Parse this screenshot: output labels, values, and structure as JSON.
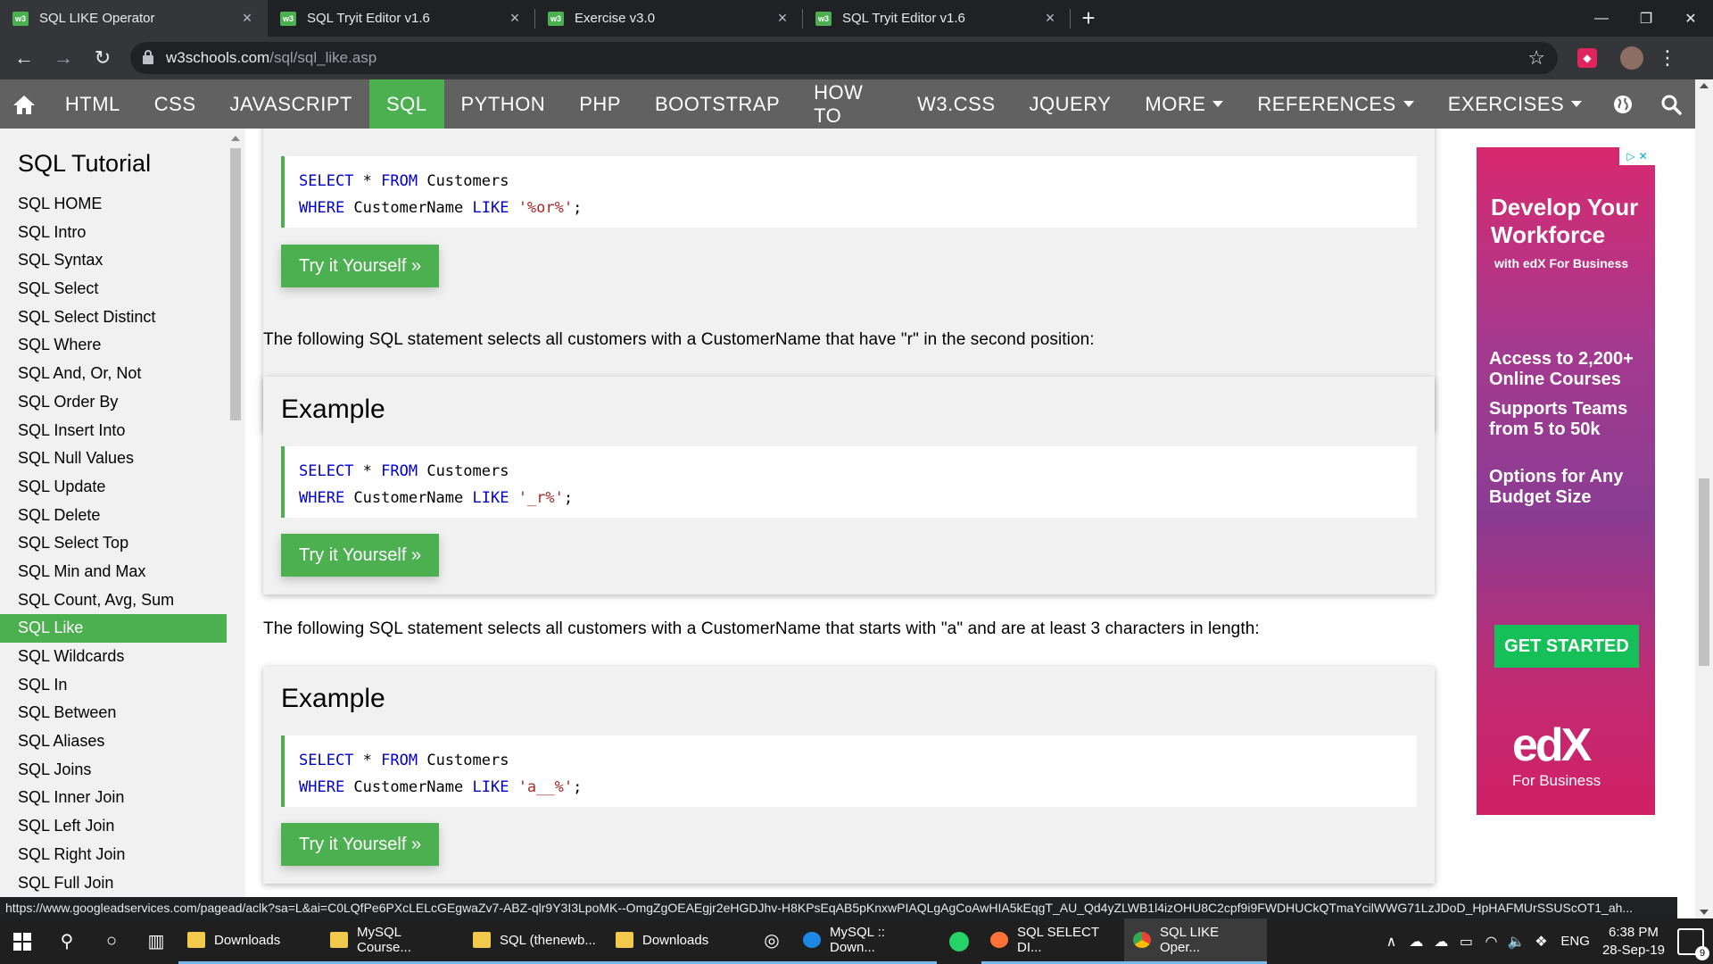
{
  "browser": {
    "tabs": [
      {
        "label": "SQL LIKE Operator",
        "favicon": "w3"
      },
      {
        "label": "SQL Tryit Editor v1.6",
        "favicon": "w3"
      },
      {
        "label": "Exercise v3.0",
        "favicon": "w3"
      },
      {
        "label": "SQL Tryit Editor v1.6",
        "favicon": "w3"
      }
    ],
    "url_host": "w3schools.com",
    "url_path": "/sql/sql_like.asp",
    "status_url": "https://www.googleadservices.com/pagead/aclk?sa=L&ai=C0LQfPe6PXcLELcGEgwaZv7-ABZ-qlr9Y3I3LpoMK--OmgZgOEAEgjr2eHGDJhv-H8KPsEqAB5pKnxwPIAQLgAgCoAwHIA5kEqgT_AU_Qd4yZLWB1l4izOHU8C2cpf9i9FWDHUCkQTmaYcilWWG71LzJDoD_HpHAFMUrSSUScOT1_ah..."
  },
  "topnav": {
    "links": [
      "HTML",
      "CSS",
      "JAVASCRIPT",
      "SQL",
      "PYTHON",
      "PHP",
      "BOOTSTRAP",
      "HOW TO",
      "W3.CSS",
      "JQUERY",
      "MORE"
    ],
    "active": "SQL",
    "right_links": [
      "REFERENCES",
      "EXERCISES"
    ]
  },
  "sidebar": {
    "title": "SQL Tutorial",
    "items": [
      "SQL HOME",
      "SQL Intro",
      "SQL Syntax",
      "SQL Select",
      "SQL Select Distinct",
      "SQL Where",
      "SQL And, Or, Not",
      "SQL Order By",
      "SQL Insert Into",
      "SQL Null Values",
      "SQL Update",
      "SQL Delete",
      "SQL Select Top",
      "SQL Min and Max",
      "SQL Count, Avg, Sum",
      "SQL Like",
      "SQL Wildcards",
      "SQL In",
      "SQL Between",
      "SQL Aliases",
      "SQL Joins",
      "SQL Inner Join",
      "SQL Left Join",
      "SQL Right Join",
      "SQL Full Join"
    ],
    "active": "SQL Like"
  },
  "main": {
    "try_label": "Try it Yourself »",
    "example_heading": "Example",
    "examples": [
      {
        "kw1": "SELECT",
        "star": " * ",
        "kw2": "FROM",
        "table": " Customers",
        "kw3": "WHERE",
        "col": " CustomerName ",
        "kw4": "LIKE",
        "pattern": "'%or%'",
        "end": ";"
      },
      {
        "kw1": "SELECT",
        "star": " * ",
        "kw2": "FROM",
        "table": " Customers",
        "kw3": "WHERE",
        "col": " CustomerName ",
        "kw4": "LIKE",
        "pattern": "'_r%'",
        "end": ";"
      },
      {
        "kw1": "SELECT",
        "star": " * ",
        "kw2": "FROM",
        "table": " Customers",
        "kw3": "WHERE",
        "col": " CustomerName ",
        "kw4": "LIKE",
        "pattern": "'a__%'",
        "end": ";"
      }
    ],
    "desc1": "The following SQL statement selects all customers with a CustomerName that have \"r\" in the second position:",
    "desc2": "The following SQL statement selects all customers with a CustomerName that starts with \"a\" and are at least 3 characters in length:"
  },
  "ad": {
    "headline": "Develop Your Workforce",
    "sub": "with edX For Business",
    "point1": "Access to 2,200+ Online Courses",
    "point2": "Supports Teams from 5 to 50k",
    "point3": "Options for Any Budget Size",
    "cta": "GET STARTED",
    "logo": "edX",
    "logo_sub": "For Business"
  },
  "taskbar": {
    "apps": [
      {
        "label": "Downloads",
        "icon": "folder-icon"
      },
      {
        "label": "MySQL Course...",
        "icon": "folder-icon"
      },
      {
        "label": "SQL (thenewb...",
        "icon": "folder-icon"
      },
      {
        "label": "Downloads",
        "icon": "folder-download-icon"
      },
      {
        "label": "MySQL :: Down...",
        "icon": "edge-icon"
      },
      {
        "label": "SQL SELECT DI...",
        "icon": "firefox-icon"
      },
      {
        "label": "SQL LIKE Oper...",
        "icon": "chrome-icon"
      }
    ],
    "lang": "ENG",
    "time": "6:38 PM",
    "date": "28-Sep-19",
    "notifications": "9"
  },
  "colors": {
    "accent": "#4caf50",
    "nav": "#616161",
    "code_kw": "mediumblue",
    "code_str": "brown"
  }
}
